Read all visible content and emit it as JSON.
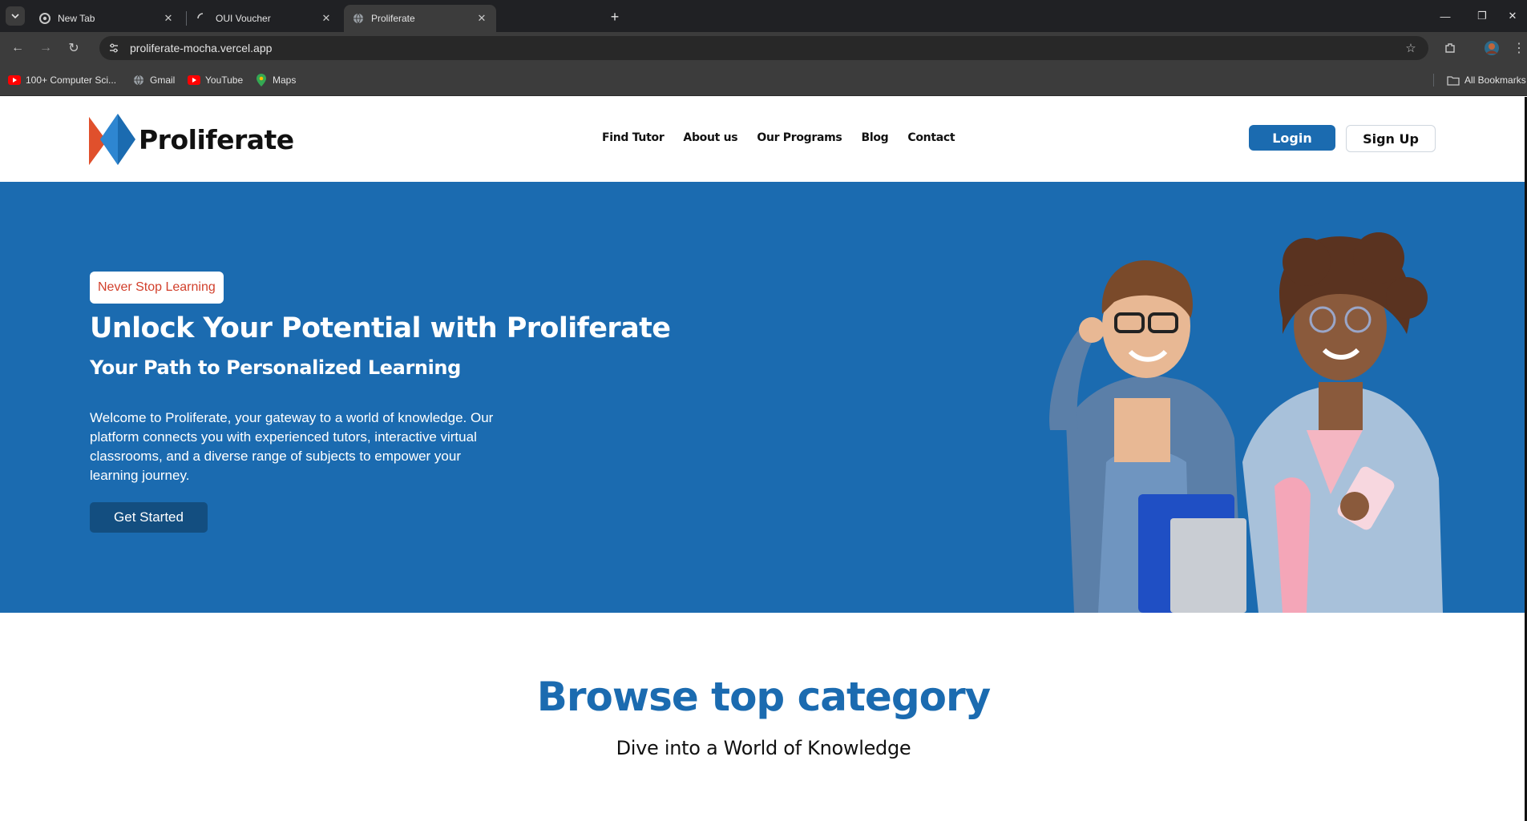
{
  "browser": {
    "tabs": [
      {
        "title": "New Tab",
        "icon": "chrome-icon"
      },
      {
        "title": "OUI Voucher",
        "icon": "loading-icon"
      },
      {
        "title": "Proliferate",
        "icon": "globe-icon",
        "active": true
      }
    ],
    "url": "proliferate-mocha.vercel.app",
    "bookmarks": [
      {
        "label": "100+ Computer Sci...",
        "icon": "youtube-icon"
      },
      {
        "label": "Gmail",
        "icon": "globe-icon"
      },
      {
        "label": "YouTube",
        "icon": "youtube-icon"
      },
      {
        "label": "Maps",
        "icon": "maps-icon"
      }
    ],
    "all_bookmarks": "All Bookmarks"
  },
  "site": {
    "brand": "Proliferate",
    "nav": [
      "Find Tutor",
      "About us",
      "Our Programs",
      "Blog",
      "Contact"
    ],
    "login": "Login",
    "signup": "Sign Up"
  },
  "hero": {
    "badge": "Never Stop Learning",
    "title": "Unlock Your Potential with Proliferate",
    "subtitle": "Your Path to Personalized Learning",
    "description": "Welcome to Proliferate, your gateway to a world of knowledge. Our platform connects you with experienced tutors, interactive virtual classrooms, and a diverse range of subjects to empower your learning journey.",
    "cta": "Get Started"
  },
  "browse": {
    "title": "Browse top category",
    "subtitle": "Dive into a World of Knowledge"
  },
  "colors": {
    "brand_blue": "#1b6bb0",
    "dark_blue": "#134e80",
    "badge_red": "#d2402c"
  }
}
